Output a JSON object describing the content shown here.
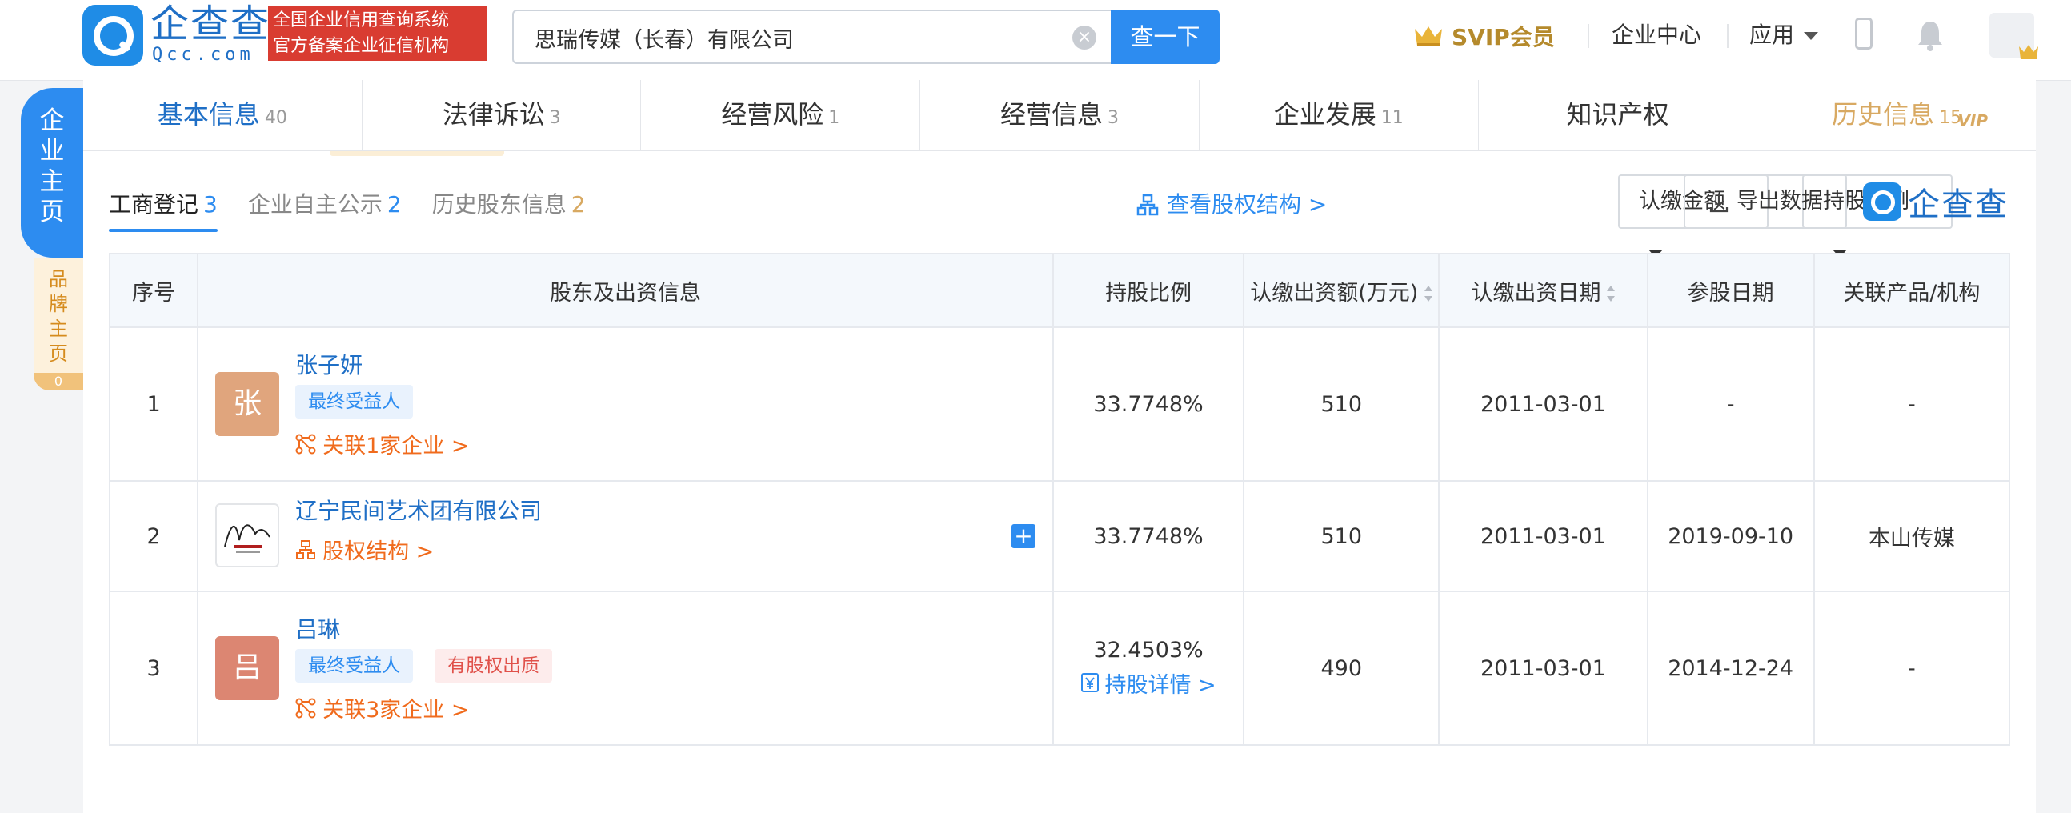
{
  "brand": {
    "name_cn": "企查查",
    "name_en": "Qcc.com",
    "slogan_line1": "全国企业信用查询系统",
    "slogan_line2": "官方备案企业征信机构"
  },
  "search": {
    "value": "思瑞传媒（长春）有限公司",
    "button": "查一下"
  },
  "header": {
    "svip": "SVIP会员",
    "enterprise_center": "企业中心",
    "apps": "应用"
  },
  "side": {
    "main_chars": [
      "企",
      "业",
      "主",
      "页"
    ],
    "brand_chars": [
      "品",
      "牌",
      "主",
      "页"
    ],
    "brand_count": "0"
  },
  "tabs": [
    {
      "label": "基本信息",
      "count": "40"
    },
    {
      "label": "法律诉讼",
      "count": "3"
    },
    {
      "label": "经营风险",
      "count": "1"
    },
    {
      "label": "经营信息",
      "count": "3"
    },
    {
      "label": "企业发展",
      "count": "11"
    },
    {
      "label": "知识产权",
      "count": ""
    },
    {
      "label": "历史信息",
      "count": "15",
      "badge": "VIP"
    }
  ],
  "subtabs": [
    {
      "label": "工商登记",
      "count": "3"
    },
    {
      "label": "企业自主公示",
      "count": "2"
    },
    {
      "label": "历史股东信息",
      "count": "2"
    }
  ],
  "toolbar": {
    "equity_link": "查看股权结构 >",
    "amount_drop": "认缴金额",
    "ratio_drop": "持股比例",
    "export": "导出数据"
  },
  "table": {
    "headers": [
      "序号",
      "股东及出资信息",
      "持股比例",
      "认缴出资额(万元)",
      "认缴出资日期",
      "参股日期",
      "关联产品/机构"
    ],
    "rows": [
      {
        "no": "1",
        "avatar_char": "张",
        "avatar_color": "#e0a57d",
        "name": "张子妍",
        "tags": [
          "最终受益人"
        ],
        "link": "关联1家企业 >",
        "ratio": "33.7748%",
        "ratio_link": "",
        "amount": "510",
        "date": "2011-03-01",
        "join_date": "-",
        "related": "-"
      },
      {
        "no": "2",
        "avatar_char": "",
        "name": "辽宁民间艺术团有限公司",
        "tags": [],
        "link": "股权结构 >",
        "ratio": "33.7748%",
        "ratio_link": "",
        "amount": "510",
        "date": "2011-03-01",
        "join_date": "2019-09-10",
        "related": "本山传媒"
      },
      {
        "no": "3",
        "avatar_char": "吕",
        "avatar_color": "#dc8672",
        "name": "吕琳",
        "tags": [
          "最终受益人",
          "有股权出质"
        ],
        "link": "关联3家企业 >",
        "ratio": "32.4503%",
        "ratio_link": "持股详情 >",
        "amount": "490",
        "date": "2011-03-01",
        "join_date": "2014-12-24",
        "related": "-"
      }
    ]
  }
}
